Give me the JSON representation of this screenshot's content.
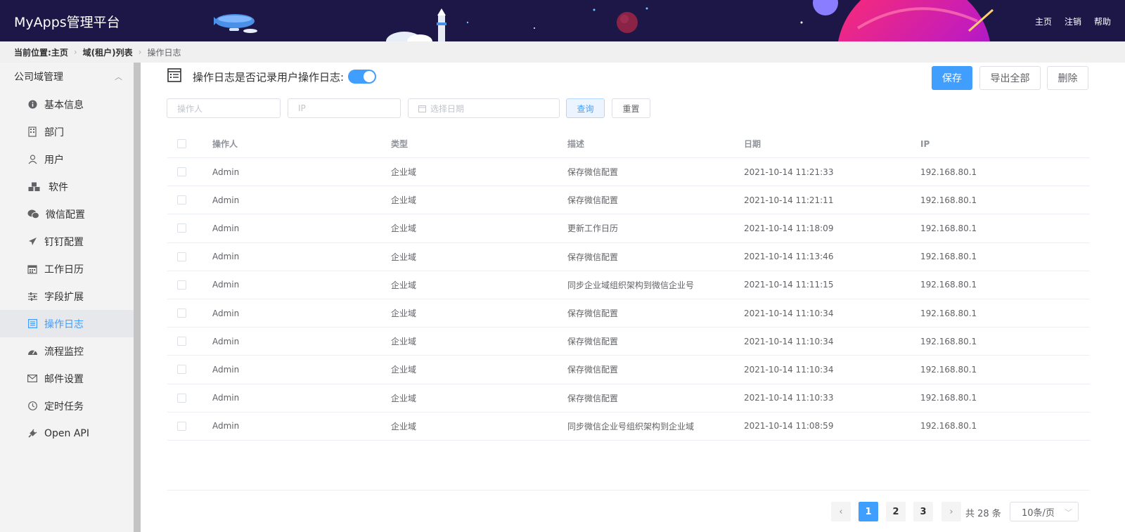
{
  "header": {
    "title": "MyApps管理平台",
    "nav": [
      "主页",
      "注销",
      "帮助"
    ]
  },
  "breadcrumb": {
    "prefix": "当前位置:",
    "items": [
      "主页",
      "域(租户)列表",
      "操作日志"
    ]
  },
  "sidebar": {
    "group": "公司域管理",
    "items": [
      {
        "label": "基本信息",
        "icon": "info-icon"
      },
      {
        "label": "部门",
        "icon": "building-icon"
      },
      {
        "label": "用户",
        "icon": "user-icon"
      },
      {
        "label": "软件",
        "icon": "cubes-icon"
      },
      {
        "label": "微信配置",
        "icon": "wechat-icon"
      },
      {
        "label": "钉钉配置",
        "icon": "plane-icon"
      },
      {
        "label": "工作日历",
        "icon": "calendar-icon"
      },
      {
        "label": "字段扩展",
        "icon": "sliders-icon"
      },
      {
        "label": "操作日志",
        "icon": "log-icon"
      },
      {
        "label": "流程监控",
        "icon": "gauge-icon"
      },
      {
        "label": "邮件设置",
        "icon": "mail-icon"
      },
      {
        "label": "定时任务",
        "icon": "clock-icon"
      },
      {
        "label": "Open API",
        "icon": "plug-icon"
      }
    ],
    "active_index": 8
  },
  "toolbar": {
    "label": "操作日志是否记录用户操作日志:",
    "switch_on": true,
    "save": "保存",
    "export": "导出全部",
    "delete": "删除"
  },
  "filters": {
    "operator_placeholder": "操作人",
    "ip_placeholder": "IP",
    "date_placeholder": "选择日期",
    "query": "查询",
    "reset": "重置"
  },
  "table": {
    "columns": [
      "操作人",
      "类型",
      "描述",
      "日期",
      "IP"
    ],
    "rows": [
      [
        "Admin",
        "企业域",
        "保存微信配置",
        "2021-10-14 11:21:33",
        "192.168.80.1"
      ],
      [
        "Admin",
        "企业域",
        "保存微信配置",
        "2021-10-14 11:21:11",
        "192.168.80.1"
      ],
      [
        "Admin",
        "企业域",
        "更新工作日历",
        "2021-10-14 11:18:09",
        "192.168.80.1"
      ],
      [
        "Admin",
        "企业域",
        "保存微信配置",
        "2021-10-14 11:13:46",
        "192.168.80.1"
      ],
      [
        "Admin",
        "企业域",
        "同步企业域组织架构到微信企业号",
        "2021-10-14 11:11:15",
        "192.168.80.1"
      ],
      [
        "Admin",
        "企业域",
        "保存微信配置",
        "2021-10-14 11:10:34",
        "192.168.80.1"
      ],
      [
        "Admin",
        "企业域",
        "保存微信配置",
        "2021-10-14 11:10:34",
        "192.168.80.1"
      ],
      [
        "Admin",
        "企业域",
        "保存微信配置",
        "2021-10-14 11:10:34",
        "192.168.80.1"
      ],
      [
        "Admin",
        "企业域",
        "保存微信配置",
        "2021-10-14 11:10:33",
        "192.168.80.1"
      ],
      [
        "Admin",
        "企业域",
        "同步微信企业号组织架构到企业域",
        "2021-10-14 11:08:59",
        "192.168.80.1"
      ]
    ]
  },
  "pagination": {
    "pages": [
      "1",
      "2",
      "3"
    ],
    "current": "1",
    "total": "共 28 条",
    "page_size": "10条/页"
  },
  "colors": {
    "header_bg": "#1d1748",
    "accent": "#409eff"
  }
}
